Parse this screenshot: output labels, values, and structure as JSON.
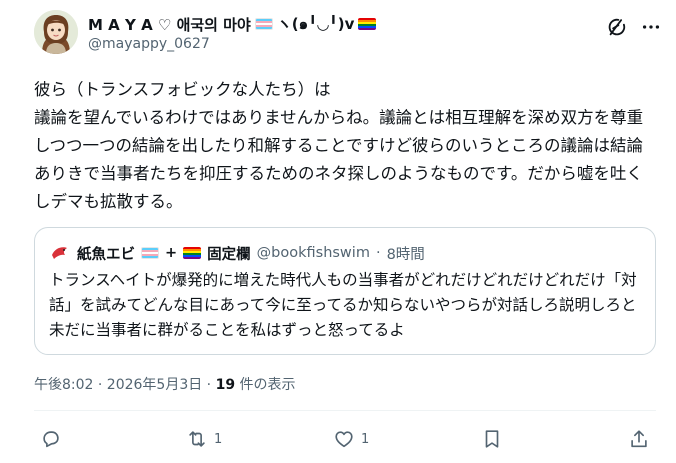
{
  "author": {
    "name_prefix": "M A Y A ♡ 애국의 마야",
    "name_kaomoji": "ヽ(๑╹◡╹)v",
    "handle": "@mayappy_0627"
  },
  "post": {
    "text": "彼ら（トランスフォビックな人たち）は\n議論を望んでいるわけではありませんからね。議論とは相互理解を深め双方を尊重しつつ一つの結論を出したり和解することですけど彼らのいうところの議論は結論ありきで当事者たちを抑圧するためのネタ探しのようなものです。だから嘘を吐くしデマも拡散する。"
  },
  "quote": {
    "name_prefix": "紙魚エビ",
    "name_plus": "+",
    "name_suffix": "固定欄",
    "handle": "@bookfishswim",
    "sep": "·",
    "time": "8時間",
    "text": "トランスヘイトが爆発的に増えた時代人もの当事者がどれだけどれだけどれだけ「対話」を試みてどんな目にあって今に至ってるか知らないやつらが対話しろ説明しろと未だに当事者に群がることを私はずっと怒ってるよ"
  },
  "meta": {
    "timestamp": "午後8:02 · 2026年5月3日 ·",
    "views_count": "19",
    "views_label": "件の表示"
  },
  "actions": {
    "retweets": "1",
    "likes": "1"
  },
  "icons": [
    "grok-icon",
    "more-icon",
    "reply-icon",
    "retweet-icon",
    "like-icon",
    "bookmark-icon",
    "share-icon"
  ],
  "colors": {
    "secondary_text": "#536471",
    "border": "#cfd9de"
  }
}
